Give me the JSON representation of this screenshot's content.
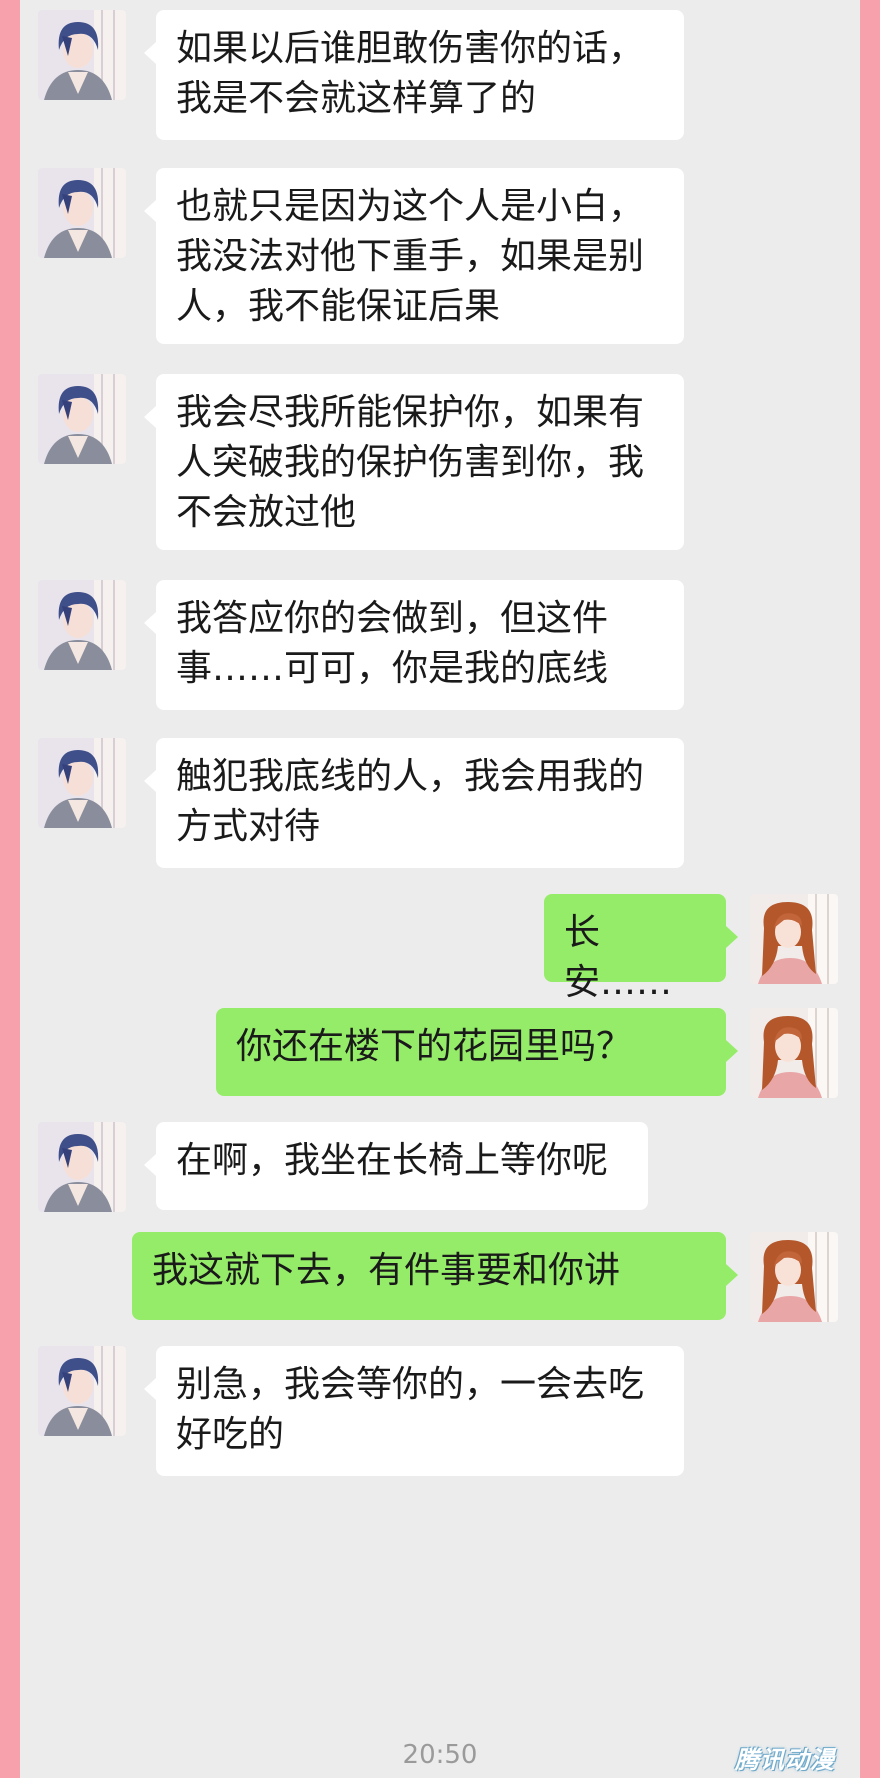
{
  "messages": [
    {
      "side": "left",
      "avatar": "male-avatar",
      "text": "如果以后谁胆敢伤害你的话，\n我是不会就这样算了的"
    },
    {
      "side": "left",
      "avatar": "male-avatar",
      "text": "也就只是因为这个人是小白，\n我没法对他下重手，如果是别\n人，我不能保证后果"
    },
    {
      "side": "left",
      "avatar": "male-avatar",
      "text": "我会尽我所能保护你，如果有\n人突破我的保护伤害到你，我\n不会放过他"
    },
    {
      "side": "left",
      "avatar": "male-avatar",
      "text": "我答应你的会做到，但这件\n事……可可，你是我的底线"
    },
    {
      "side": "left",
      "avatar": "male-avatar",
      "text": "触犯我底线的人，我会用我的\n方式对待"
    },
    {
      "side": "right",
      "avatar": "female-avatar",
      "text": "长安……"
    },
    {
      "side": "right",
      "avatar": "female-avatar",
      "text": "你还在楼下的花园里吗？"
    },
    {
      "side": "left",
      "avatar": "male-avatar",
      "text": "在啊，我坐在长椅上等你呢"
    },
    {
      "side": "right",
      "avatar": "female-avatar",
      "text": "我这就下去，有件事要和你讲"
    },
    {
      "side": "left",
      "avatar": "male-avatar",
      "text": "别急，我会等你的，一会去吃\n好吃的"
    }
  ],
  "timestamp": "20:50",
  "watermark": "腾讯动漫",
  "colors": {
    "frame": "#f7a1ad",
    "chat_background": "#ececec",
    "incoming_bubble": "#ffffff",
    "outgoing_bubble": "#95ec69"
  }
}
